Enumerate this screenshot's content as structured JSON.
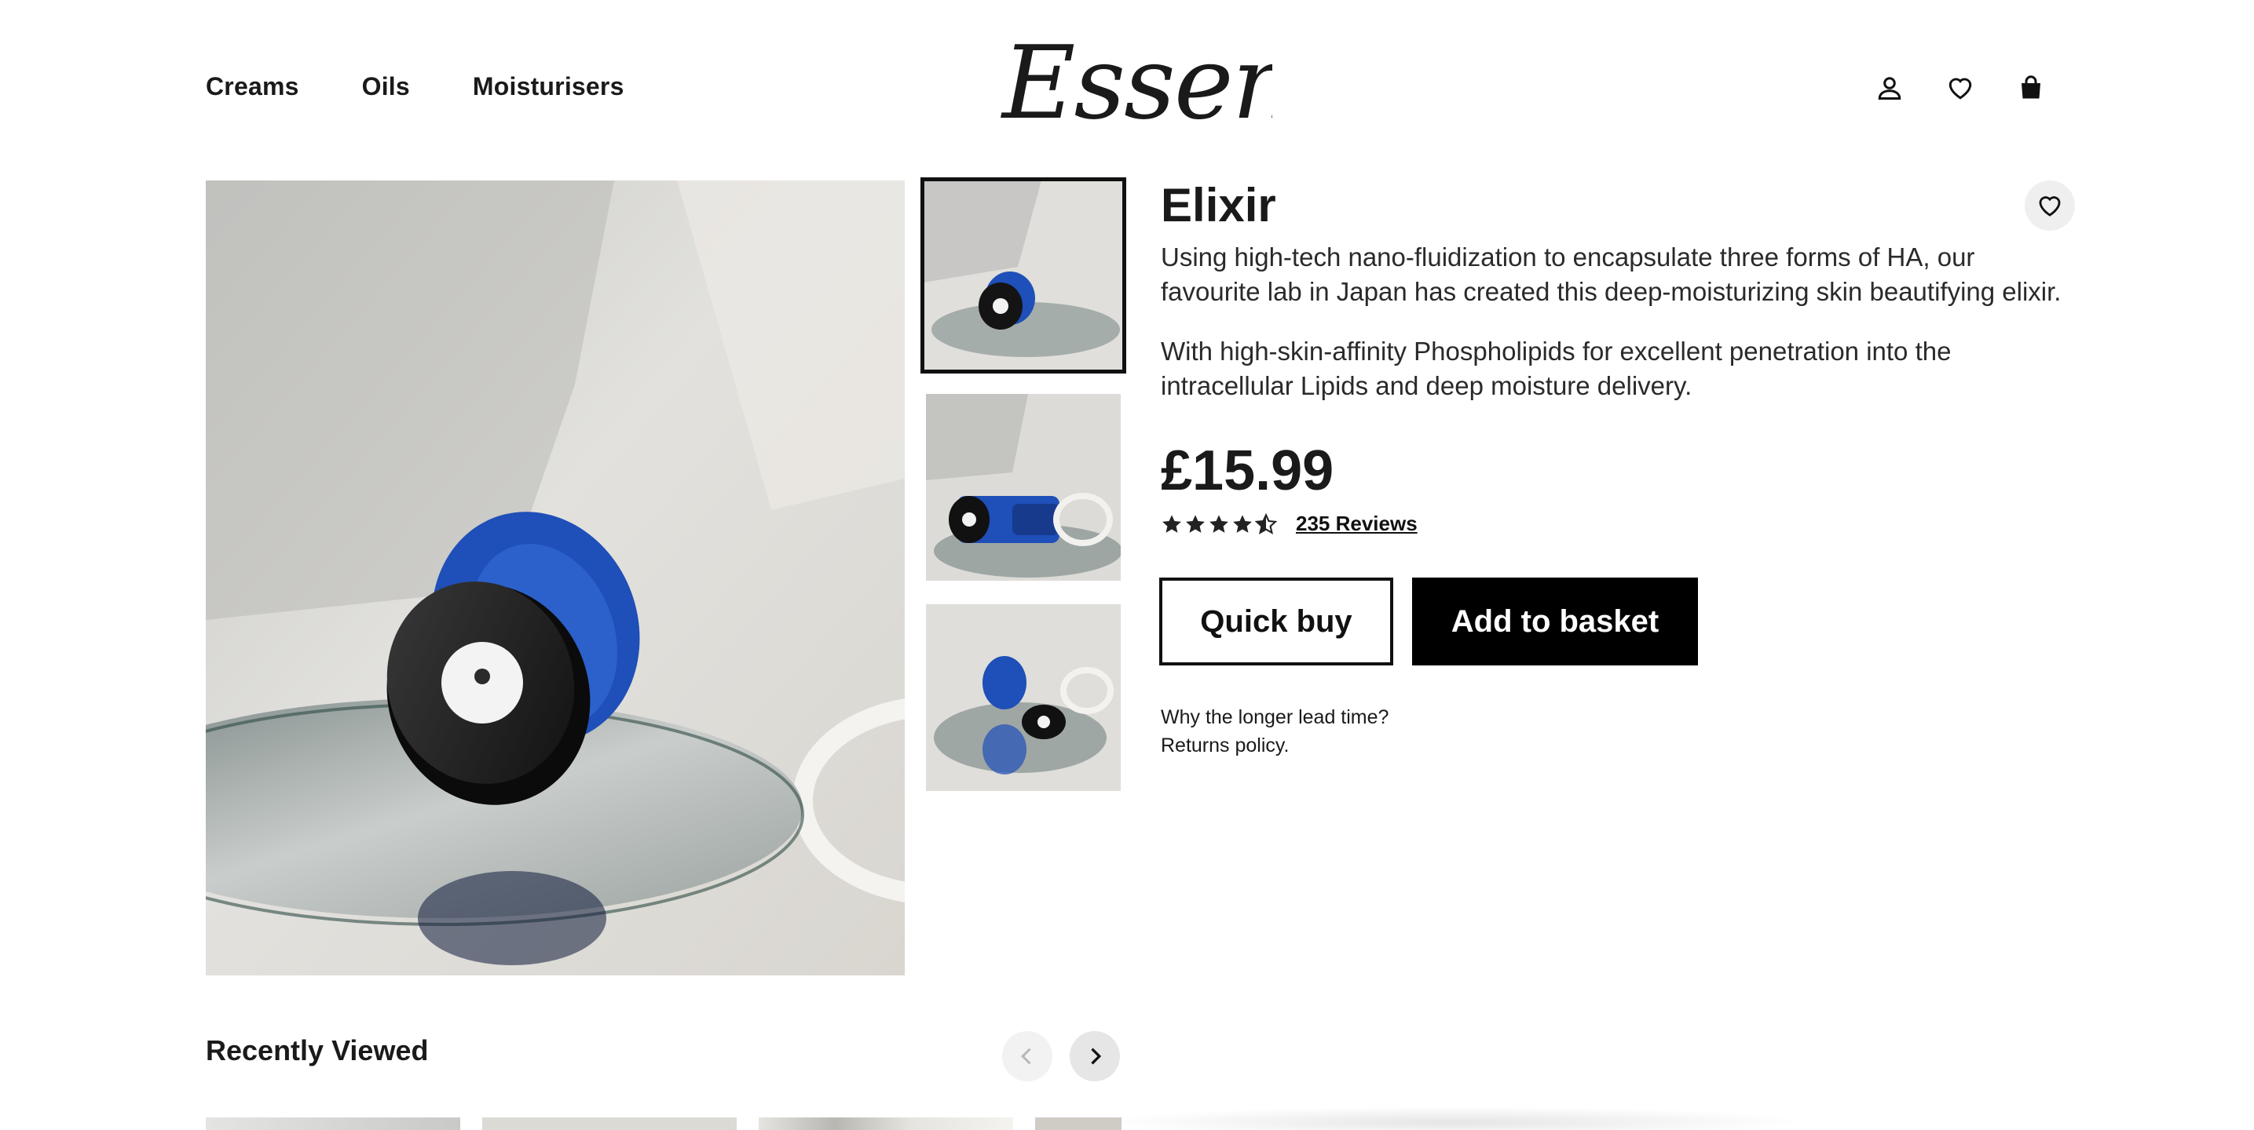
{
  "header": {
    "nav": [
      "Creams",
      "Oils",
      "Moisturisers"
    ],
    "logo_text": "Essence",
    "icons": [
      "account-icon",
      "heart-icon",
      "bag-icon"
    ]
  },
  "product": {
    "title": "Elixir",
    "description": [
      "Using high-tech nano-fluidization to encapsulate three forms of HA, our favourite lab in Japan has created this deep-moisturizing skin beautifying elixir.",
      "With high-skin-affinity Phospholipids for excellent penetration into the intracellular Lipids and deep moisture delivery."
    ],
    "price": "£15.99",
    "rating": 4.5,
    "reviews_label": "235 Reviews",
    "quick_buy_label": "Quick buy",
    "add_to_basket_label": "Add to basket",
    "lead_time_link": "Why the longer lead time?",
    "returns_link": "Returns policy."
  },
  "gallery": {
    "thumbnail_count": 3,
    "active_thumbnail": 1
  },
  "recently_viewed": {
    "title": "Recently Viewed",
    "prev_icon": "chevron-left-icon",
    "next_icon": "chevron-right-icon"
  },
  "colors": {
    "primary": "#000000",
    "jar_blue": "#1f4fb8",
    "background": "#ffffff"
  }
}
